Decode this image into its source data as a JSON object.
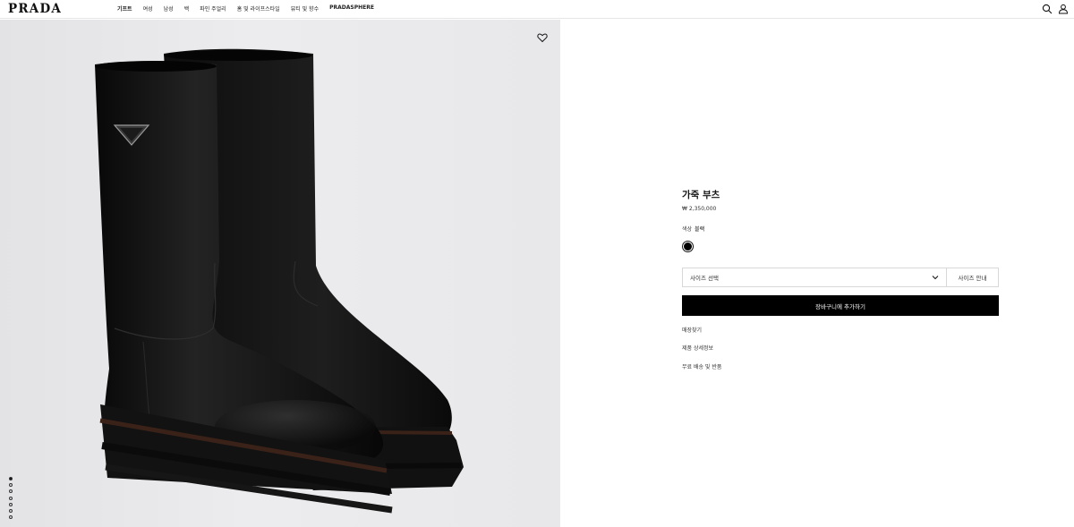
{
  "brand": {
    "logo": "PRADA"
  },
  "nav": {
    "items": [
      "기프트",
      "여성",
      "남성",
      "백",
      "파인 주얼리",
      "홈 및 라이프스타일",
      "뷰티 및 향수",
      "PRADASPHERE"
    ]
  },
  "header_icons": [
    "search-icon",
    "user-icon"
  ],
  "gallery": {
    "image_count": 7,
    "active_index": 0,
    "wishlist_icon": "heart-icon"
  },
  "product": {
    "title": "가죽 부츠",
    "price": "₩ 2,350,000",
    "color_label": "색상",
    "color_value": "블랙",
    "swatch_color": "#000000",
    "size_placeholder": "사이즈 선택",
    "size_guide": "사이즈 안내",
    "add_to_cart": "장바구니에 추가하기",
    "links": [
      "매장찾기",
      "제품 상세정보",
      "무료 배송 및 반품"
    ]
  },
  "colors": {
    "accent": "#000000",
    "background": "#ffffff",
    "image_bg": "#e8e8ea"
  }
}
